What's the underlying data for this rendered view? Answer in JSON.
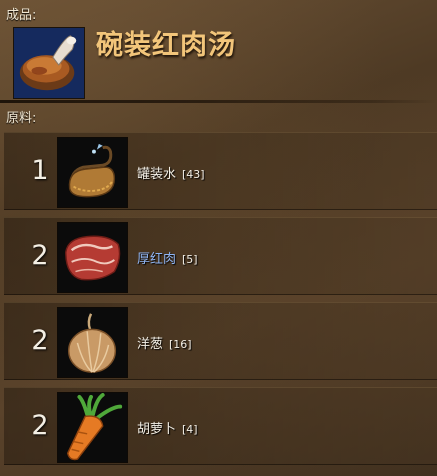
{
  "product": {
    "section_label": "成品:",
    "name": "碗装红肉汤",
    "icon": "bowl-of-red-meat-soup-icon"
  },
  "materials": {
    "section_label": "原料:",
    "items": [
      {
        "quantity": "1",
        "name": "罐装水",
        "count": "[43]",
        "icon": "jug-of-water-icon",
        "color": "#f3efe6"
      },
      {
        "quantity": "2",
        "name": "厚红肉",
        "count": "[5]",
        "icon": "red-meat-icon",
        "color": "#8fb4f2"
      },
      {
        "quantity": "2",
        "name": "洋葱",
        "count": "[16]",
        "icon": "onion-icon",
        "color": "#f3efe6"
      },
      {
        "quantity": "2",
        "name": "胡萝卜",
        "count": "[4]",
        "icon": "carrot-icon",
        "color": "#f3efe6"
      }
    ]
  },
  "colors": {
    "title": "#f2c57a",
    "link_text": "#8fb4f2",
    "background": "#5a432b"
  }
}
